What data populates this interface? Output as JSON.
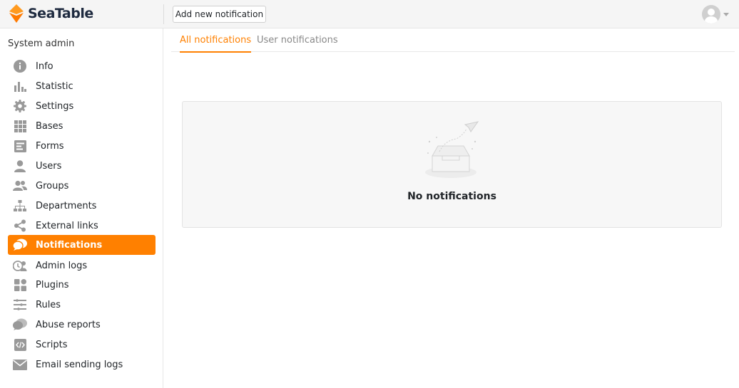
{
  "app": {
    "name": "SeaTable",
    "brand_color": "#ff8000"
  },
  "header": {
    "add_button_label": "Add new notification"
  },
  "sidebar": {
    "title": "System admin",
    "items": [
      {
        "label": "Info",
        "icon": "info-icon",
        "active": false
      },
      {
        "label": "Statistic",
        "icon": "bar-chart-icon",
        "active": false
      },
      {
        "label": "Settings",
        "icon": "gear-icon",
        "active": false
      },
      {
        "label": "Bases",
        "icon": "grid-icon",
        "active": false
      },
      {
        "label": "Forms",
        "icon": "form-icon",
        "active": false
      },
      {
        "label": "Users",
        "icon": "user-icon",
        "active": false
      },
      {
        "label": "Groups",
        "icon": "group-icon",
        "active": false
      },
      {
        "label": "Departments",
        "icon": "org-chart-icon",
        "active": false
      },
      {
        "label": "External links",
        "icon": "share-icon",
        "active": false
      },
      {
        "label": "Notifications",
        "icon": "notification-bubble-icon",
        "active": true
      },
      {
        "label": "Admin logs",
        "icon": "admin-log-icon",
        "active": false
      },
      {
        "label": "Plugins",
        "icon": "plugin-icon",
        "active": false
      },
      {
        "label": "Rules",
        "icon": "rules-icon",
        "active": false
      },
      {
        "label": "Abuse reports",
        "icon": "report-bubble-icon",
        "active": false
      },
      {
        "label": "Scripts",
        "icon": "code-icon",
        "active": false
      },
      {
        "label": "Email sending logs",
        "icon": "envelope-icon",
        "active": false
      }
    ]
  },
  "tabs": [
    {
      "label": "All notifications",
      "active": true
    },
    {
      "label": "User notifications",
      "active": false
    }
  ],
  "main": {
    "empty_message": "No notifications"
  }
}
